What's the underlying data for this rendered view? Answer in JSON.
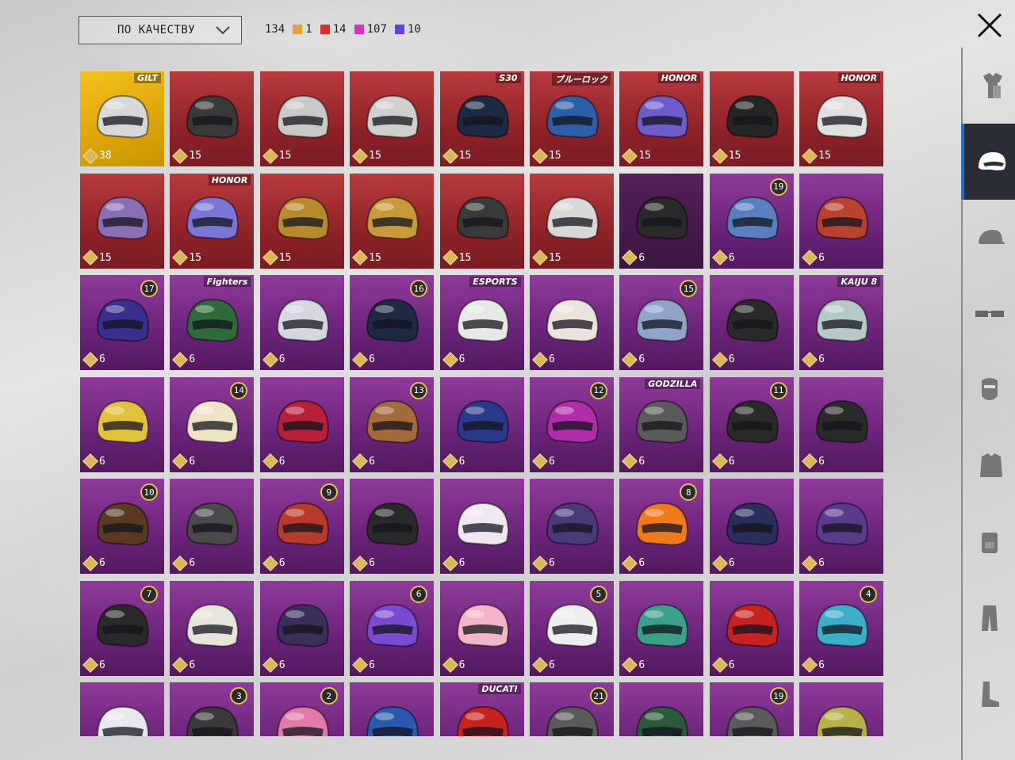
{
  "toolbar": {
    "sort_label": "ПО КАЧЕСТВУ",
    "total_count": "134",
    "quality_counts": [
      {
        "color": "#e9a23b",
        "count": "1"
      },
      {
        "color": "#e02b2b",
        "count": "14"
      },
      {
        "color": "#d630c6",
        "count": "107"
      },
      {
        "color": "#6a3de0",
        "count": "10"
      }
    ]
  },
  "colors": {
    "legendary": "#b83a3e",
    "epic": "#8f3a9b",
    "mythic": "#f3c31a",
    "accent": "#1f6fd1"
  },
  "grid": {
    "items": [
      {
        "rarity": "gold",
        "value": "38",
        "brand": "GILT",
        "helmet": "#d8d8d8"
      },
      {
        "rarity": "red",
        "value": "15",
        "helmet": "#3a3a3a"
      },
      {
        "rarity": "red",
        "value": "15",
        "helmet": "#c9c9c9"
      },
      {
        "rarity": "red",
        "value": "15",
        "helmet": "#cfcfcf"
      },
      {
        "rarity": "red",
        "value": "15",
        "brand": "S30",
        "helmet": "#1e2a44"
      },
      {
        "rarity": "red",
        "value": "15",
        "brand": "ブルーロック",
        "helmet": "#2b5fa7"
      },
      {
        "rarity": "red",
        "value": "15",
        "brand": "HONOR",
        "helmet": "#6d5cc9"
      },
      {
        "rarity": "red",
        "value": "15",
        "helmet": "#262626"
      },
      {
        "rarity": "red",
        "value": "15",
        "brand": "HONOR",
        "helmet": "#e0e0e0"
      },
      {
        "rarity": "red",
        "value": "15",
        "helmet": "#8b6fb5"
      },
      {
        "rarity": "red",
        "value": "15",
        "brand": "HONOR",
        "helmet": "#7a75d6"
      },
      {
        "rarity": "red",
        "value": "15",
        "helmet": "#b78a2c"
      },
      {
        "rarity": "red",
        "value": "15",
        "helmet": "#c89a3a"
      },
      {
        "rarity": "red",
        "value": "15",
        "helmet": "#3a3a3a"
      },
      {
        "rarity": "red",
        "value": "15",
        "helmet": "#d8d8d8"
      },
      {
        "rarity": "dark",
        "value": "6",
        "helmet": "#2a2a2a"
      },
      {
        "rarity": "purple",
        "value": "6",
        "badge": "19",
        "helmet": "#5a7fc1"
      },
      {
        "rarity": "purple",
        "value": "6",
        "helmet": "#b8412f"
      },
      {
        "rarity": "purple",
        "value": "6",
        "badge": "17",
        "helmet": "#3a2e8f"
      },
      {
        "rarity": "purple",
        "value": "6",
        "brand": "Fighters",
        "helmet": "#2f6b3a"
      },
      {
        "rarity": "purple",
        "value": "6",
        "helmet": "#d6d6e0"
      },
      {
        "rarity": "purple",
        "value": "6",
        "badge": "16",
        "helmet": "#1e2a44"
      },
      {
        "rarity": "purple",
        "value": "6",
        "brand": "ESPORTS",
        "helmet": "#e8e8e8"
      },
      {
        "rarity": "purple",
        "value": "6",
        "helmet": "#ece4dc"
      },
      {
        "rarity": "purple",
        "value": "6",
        "badge": "15",
        "helmet": "#8fa4c8"
      },
      {
        "rarity": "purple",
        "value": "6",
        "helmet": "#2a2a2a"
      },
      {
        "rarity": "purple",
        "value": "6",
        "brand": "KAIJU 8",
        "helmet": "#b5c9c6"
      },
      {
        "rarity": "purple",
        "value": "6",
        "helmet": "#e2c23a"
      },
      {
        "rarity": "purple",
        "value": "6",
        "badge": "14",
        "helmet": "#efe3c7"
      },
      {
        "rarity": "purple",
        "value": "6",
        "helmet": "#b81f3a"
      },
      {
        "rarity": "purple",
        "value": "6",
        "badge": "13",
        "helmet": "#a46a3a"
      },
      {
        "rarity": "purple",
        "value": "6",
        "helmet": "#2a3a8a"
      },
      {
        "rarity": "purple",
        "value": "6",
        "badge": "12",
        "helmet": "#b02ca8"
      },
      {
        "rarity": "purple",
        "value": "6",
        "brand": "GODZILLA",
        "helmet": "#5a5a5a"
      },
      {
        "rarity": "purple",
        "value": "6",
        "badge": "11",
        "helmet": "#2a2a2a"
      },
      {
        "rarity": "purple",
        "value": "6",
        "helmet": "#2a2a2a"
      },
      {
        "rarity": "purple",
        "value": "6",
        "badge": "10",
        "helmet": "#5a3a22"
      },
      {
        "rarity": "purple",
        "value": "6",
        "helmet": "#4a4a4a"
      },
      {
        "rarity": "purple",
        "value": "6",
        "badge": "9",
        "helmet": "#b83a2a"
      },
      {
        "rarity": "purple",
        "value": "6",
        "helmet": "#2a2a2a"
      },
      {
        "rarity": "purple",
        "value": "6",
        "helmet": "#f0e8f0"
      },
      {
        "rarity": "purple",
        "value": "6",
        "helmet": "#4a3a7a"
      },
      {
        "rarity": "purple",
        "value": "6",
        "badge": "8",
        "helmet": "#f07a1a"
      },
      {
        "rarity": "purple",
        "value": "6",
        "helmet": "#2a2e5a"
      },
      {
        "rarity": "purple",
        "value": "6",
        "helmet": "#5a3a8a"
      },
      {
        "rarity": "purple",
        "value": "6",
        "badge": "7",
        "helmet": "#2a2a2a"
      },
      {
        "rarity": "purple",
        "value": "6",
        "helmet": "#e8e4dc"
      },
      {
        "rarity": "purple",
        "value": "6",
        "helmet": "#3a2e5a"
      },
      {
        "rarity": "purple",
        "value": "6",
        "badge": "6",
        "helmet": "#7a4ad0"
      },
      {
        "rarity": "purple",
        "value": "6",
        "helmet": "#f2b6c8"
      },
      {
        "rarity": "purple",
        "value": "6",
        "badge": "5",
        "helmet": "#eeeeee"
      },
      {
        "rarity": "purple",
        "value": "6",
        "helmet": "#3aa08a"
      },
      {
        "rarity": "purple",
        "value": "6",
        "helmet": "#c8221f"
      },
      {
        "rarity": "purple",
        "value": "6",
        "badge": "4",
        "helmet": "#3ab0c8"
      },
      {
        "rarity": "purple",
        "value": "",
        "helmet": "#e8e8f0"
      },
      {
        "rarity": "purple",
        "value": "",
        "badge": "3",
        "helmet": "#3a3a3a"
      },
      {
        "rarity": "purple",
        "value": "",
        "badge": "2",
        "helmet": "#e07aa8"
      },
      {
        "rarity": "purple",
        "value": "",
        "helmet": "#2a5ab0"
      },
      {
        "rarity": "purple",
        "value": "",
        "brand": "DUCATI",
        "helmet": "#c8221f"
      },
      {
        "rarity": "purple",
        "value": "",
        "badge": "21",
        "helmet": "#5a5a5a"
      },
      {
        "rarity": "purple",
        "value": "",
        "helmet": "#2a5a3a"
      },
      {
        "rarity": "purple",
        "value": "",
        "badge": "19",
        "helmet": "#5a5a5a"
      },
      {
        "rarity": "purple",
        "value": "",
        "helmet": "#b8b04a"
      }
    ]
  },
  "sidebar": {
    "items": [
      {
        "icon": "outfit-icon",
        "active": false
      },
      {
        "icon": "helmet-icon",
        "active": true
      },
      {
        "icon": "cap-icon",
        "active": false
      },
      {
        "icon": "glasses-icon",
        "active": false
      },
      {
        "icon": "mask-icon",
        "active": false
      },
      {
        "icon": "jacket-icon",
        "active": false
      },
      {
        "icon": "backpack-icon",
        "active": false
      },
      {
        "icon": "pants-icon",
        "active": false
      },
      {
        "icon": "shoes-icon",
        "active": false
      }
    ]
  }
}
